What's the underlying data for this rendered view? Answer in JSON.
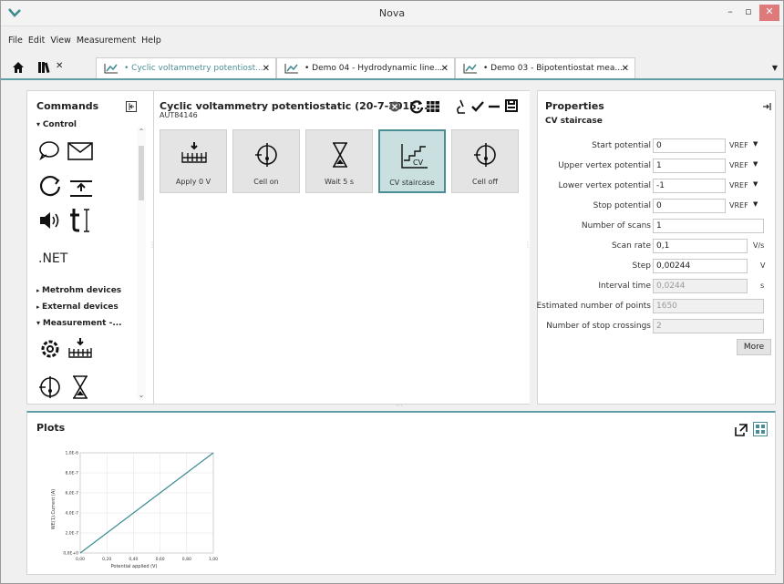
{
  "window": {
    "title": "Nova"
  },
  "menu": [
    "File",
    "Edit",
    "View",
    "Measurement",
    "Help"
  ],
  "tabs": [
    {
      "label": "• Cyclic voltammetry potentiost...",
      "active": true
    },
    {
      "label": "• Demo 04 - Hydrodynamic line...",
      "active": false
    },
    {
      "label": "• Demo 03 - Bipotentiostat mea...",
      "active": false
    }
  ],
  "commands": {
    "title": "Commands",
    "sections": {
      "control": "Control",
      "net": ".NET",
      "metrohm": "Metrohm devices",
      "external": "External devices",
      "measurement": "Measurement -..."
    }
  },
  "procedure": {
    "title": "Cyclic voltammetry potentiostatic (20-7-2015...",
    "subtitle": "AUT84146",
    "cards": [
      {
        "label": "Apply 0 V",
        "icon": "apply-potential-icon"
      },
      {
        "label": "Cell on",
        "icon": "cell-on-icon"
      },
      {
        "label": "Wait 5 s",
        "icon": "hourglass-icon"
      },
      {
        "label": "CV staircase",
        "icon": "cv-staircase-icon",
        "selected": true
      },
      {
        "label": "Cell off",
        "icon": "cell-off-icon"
      }
    ]
  },
  "properties": {
    "title": "Properties",
    "section": "CV staircase",
    "rows": [
      {
        "label": "Start potential",
        "value": "0",
        "unit": "VREF",
        "dropdown": true
      },
      {
        "label": "Upper vertex potential",
        "value": "1",
        "unit": "VREF",
        "dropdown": true
      },
      {
        "label": "Lower vertex potential",
        "value": "-1",
        "unit": "VREF",
        "dropdown": true
      },
      {
        "label": "Stop potential",
        "value": "0",
        "unit": "VREF",
        "dropdown": true
      },
      {
        "label": "Number of scans",
        "value": "1",
        "unit": ""
      },
      {
        "label": "Scan rate",
        "value": "0,1",
        "unit": "V/s"
      },
      {
        "label": "Step",
        "value": "0,00244",
        "unit": "V"
      },
      {
        "label": "Interval time",
        "value": "0,0244",
        "unit": "s",
        "readonly": true
      },
      {
        "label": "Estimated number of points",
        "value": "1650",
        "unit": "",
        "readonly": true
      },
      {
        "label": "Number of stop crossings",
        "value": "2",
        "unit": "",
        "readonly": true
      }
    ],
    "more_label": "More"
  },
  "plots": {
    "title": "Plots",
    "chart_data": {
      "type": "line",
      "xlabel": "Potential applied (V)",
      "ylabel": "WE(1).Current (A)",
      "x": [
        0.0,
        0.2,
        0.4,
        0.6,
        0.8,
        1.0
      ],
      "y": [
        0.0,
        2e-07,
        4e-07,
        6e-07,
        8e-07,
        1e-06
      ],
      "x_ticks": [
        "0,00",
        "0,20",
        "0,40",
        "0,60",
        "0,80",
        "1,00"
      ],
      "y_ticks": [
        "0,0E+0",
        "2,0E-7",
        "4,0E-7",
        "6,0E-7",
        "8,0E-7",
        "1,0E-6"
      ],
      "xlim": [
        0,
        1.0
      ],
      "ylim": [
        0,
        1e-06
      ]
    }
  }
}
